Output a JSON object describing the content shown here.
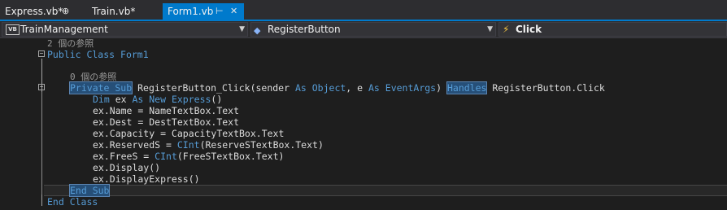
{
  "tabs": [
    {
      "label": "Express.vb*",
      "icon": "pin-icon",
      "icon_glyph": "⊕"
    },
    {
      "label": "Train.vb*"
    },
    {
      "label": "Form1.vb",
      "icon": "pin-icon",
      "icon_glyph": "⊢",
      "close_glyph": "✕",
      "active": true
    }
  ],
  "navbar": {
    "project": {
      "icon": "vb-icon",
      "badge": "VB",
      "label": "TrainManagement"
    },
    "member": {
      "icon": "cube-icon",
      "label": "RegisterButton"
    },
    "event": {
      "icon": "lightning-icon",
      "label": "Click"
    },
    "dropdown_glyph": "▼"
  },
  "code": {
    "ref_class": "2 個の参照",
    "ref_sub": "0 個の参照",
    "collapse_glyph": "−",
    "lines": {
      "class_kw": "Public Class ",
      "class_name": "Form1",
      "private_sub": "Private Sub",
      "sub_sig_1": " RegisterButton_Click(sender ",
      "as_1": "As",
      "object_t": " Object",
      "sub_sig_2": ", e ",
      "as_2": "As",
      "eventargs_t": " EventArgs",
      "sub_sig_3": ") ",
      "handles": "Handles",
      "sub_sig_4": " RegisterButton.Click",
      "dim_kw": "Dim",
      "dim_1": " ex ",
      "dim_as_new": "As New",
      "dim_type": " Express",
      "dim_2": "()",
      "name": "ex.Name = NameTextBox.Text",
      "dest": "ex.Dest = DestTextBox.Text",
      "capacity": "ex.Capacity = CapacityTextBox.Text",
      "reserved_1": "ex.ReservedS = ",
      "cint": "CInt",
      "reserved_2": "(ReserveSTextBox.Text)",
      "frees_1": "ex.FreeS = ",
      "frees_2": "(FreeSTextBox.Text)",
      "display": "ex.Display()",
      "display_express": "ex.DisplayExpress()",
      "end_sub": "End Sub",
      "end_class": "End Class"
    }
  }
}
